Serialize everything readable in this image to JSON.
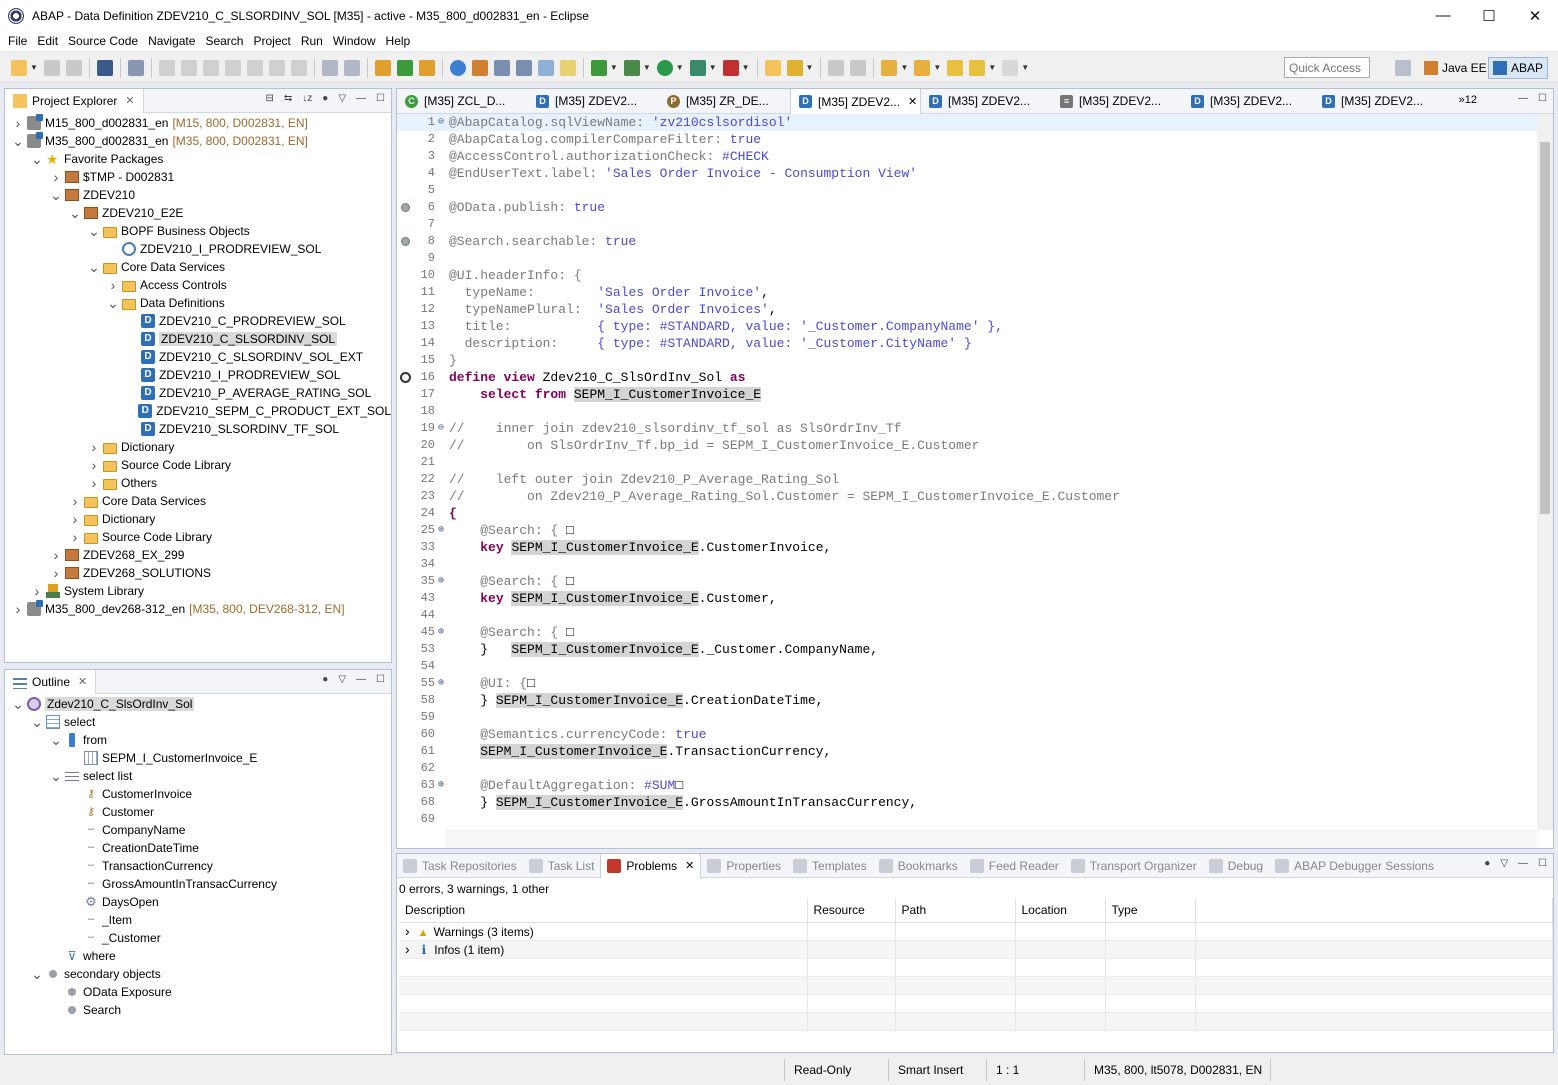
{
  "window": {
    "title": "ABAP - Data Definition ZDEV210_C_SLSORDINV_SOL [M35] - active - M35_800_d002831_en - Eclipse",
    "controls": [
      "—",
      "☐",
      "✕"
    ]
  },
  "menu": [
    "File",
    "Edit",
    "Source Code",
    "Navigate",
    "Search",
    "Project",
    "Run",
    "Window",
    "Help"
  ],
  "toolbar": {
    "quick_access_placeholder": "Quick Access",
    "perspectives": [
      "Java EE",
      "ABAP"
    ]
  },
  "project_explorer": {
    "tab_label": "Project Explorer",
    "tree": [
      {
        "indent": 0,
        "twisty": ">",
        "icon": "proj",
        "label": "M15_800_d002831_en",
        "meta": "[M15, 800, D002831, EN]"
      },
      {
        "indent": 0,
        "twisty": "v",
        "icon": "proj",
        "label": "M35_800_d002831_en",
        "meta": "[M35, 800, D002831, EN]"
      },
      {
        "indent": 1,
        "twisty": "v",
        "icon": "star",
        "label": "Favorite Packages"
      },
      {
        "indent": 2,
        "twisty": ">",
        "icon": "pkg",
        "label": "$TMP - D002831"
      },
      {
        "indent": 2,
        "twisty": "v",
        "icon": "pkg",
        "label": "ZDEV210"
      },
      {
        "indent": 3,
        "twisty": "v",
        "icon": "pkg",
        "label": "ZDEV210_E2E"
      },
      {
        "indent": 4,
        "twisty": "v",
        "icon": "folder",
        "label": "BOPF Business Objects"
      },
      {
        "indent": 5,
        "twisty": "",
        "icon": "bopf",
        "label": "ZDEV210_I_PRODREVIEW_SOL"
      },
      {
        "indent": 4,
        "twisty": "v",
        "icon": "folder",
        "label": "Core Data Services"
      },
      {
        "indent": 5,
        "twisty": ">",
        "icon": "folder",
        "label": "Access Controls"
      },
      {
        "indent": 5,
        "twisty": "v",
        "icon": "folder",
        "label": "Data Definitions"
      },
      {
        "indent": 6,
        "twisty": "",
        "icon": "ddl",
        "label": "ZDEV210_C_PRODREVIEW_SOL"
      },
      {
        "indent": 6,
        "twisty": "",
        "icon": "ddl",
        "label": "ZDEV210_C_SLSORDINV_SOL",
        "selected": true
      },
      {
        "indent": 6,
        "twisty": "",
        "icon": "ddl",
        "label": "ZDEV210_C_SLSORDINV_SOL_EXT"
      },
      {
        "indent": 6,
        "twisty": "",
        "icon": "ddl",
        "label": "ZDEV210_I_PRODREVIEW_SOL"
      },
      {
        "indent": 6,
        "twisty": "",
        "icon": "ddl",
        "label": "ZDEV210_P_AVERAGE_RATING_SOL"
      },
      {
        "indent": 6,
        "twisty": "",
        "icon": "ddl",
        "label": "ZDEV210_SEPM_C_PRODUCT_EXT_SOL"
      },
      {
        "indent": 6,
        "twisty": "",
        "icon": "ddl",
        "label": "ZDEV210_SLSORDINV_TF_SOL"
      },
      {
        "indent": 4,
        "twisty": ">",
        "icon": "folder",
        "label": "Dictionary"
      },
      {
        "indent": 4,
        "twisty": ">",
        "icon": "folder",
        "label": "Source Code Library"
      },
      {
        "indent": 4,
        "twisty": ">",
        "icon": "folder",
        "label": "Others"
      },
      {
        "indent": 3,
        "twisty": ">",
        "icon": "folder",
        "label": "Core Data Services"
      },
      {
        "indent": 3,
        "twisty": ">",
        "icon": "folder",
        "label": "Dictionary"
      },
      {
        "indent": 3,
        "twisty": ">",
        "icon": "folder",
        "label": "Source Code Library"
      },
      {
        "indent": 2,
        "twisty": ">",
        "icon": "pkg",
        "label": "ZDEV268_EX_299"
      },
      {
        "indent": 2,
        "twisty": ">",
        "icon": "pkg",
        "label": "ZDEV268_SOLUTIONS"
      },
      {
        "indent": 1,
        "twisty": ">",
        "icon": "sys",
        "label": "System Library"
      },
      {
        "indent": 0,
        "twisty": ">",
        "icon": "proj",
        "label": "M35_800_dev268-312_en",
        "meta": "[M35, 800, DEV268-312, EN]"
      }
    ]
  },
  "outline": {
    "tab_label": "Outline",
    "tree": [
      {
        "indent": 0,
        "twisty": "v",
        "icon": "view",
        "label": "Zdev210_C_SlsOrdInv_Sol",
        "selected": true
      },
      {
        "indent": 1,
        "twisty": "v",
        "icon": "sel",
        "label": "select"
      },
      {
        "indent": 2,
        "twisty": "v",
        "icon": "from",
        "label": "from"
      },
      {
        "indent": 3,
        "twisty": "",
        "icon": "table",
        "label": "SEPM_I_CustomerInvoice_E"
      },
      {
        "indent": 2,
        "twisty": "v",
        "icon": "list",
        "label": "select list"
      },
      {
        "indent": 3,
        "twisty": "",
        "icon": "key",
        "label": "CustomerInvoice"
      },
      {
        "indent": 3,
        "twisty": "",
        "icon": "key",
        "label": "Customer"
      },
      {
        "indent": 3,
        "twisty": "",
        "icon": "attr",
        "label": "CompanyName"
      },
      {
        "indent": 3,
        "twisty": "",
        "icon": "attr",
        "label": "CreationDateTime"
      },
      {
        "indent": 3,
        "twisty": "",
        "icon": "attr",
        "label": "TransactionCurrency"
      },
      {
        "indent": 3,
        "twisty": "",
        "icon": "attr",
        "label": "GrossAmountInTransacCurrency"
      },
      {
        "indent": 3,
        "twisty": "",
        "icon": "gear",
        "label": "DaysOpen"
      },
      {
        "indent": 3,
        "twisty": "",
        "icon": "attr",
        "label": "_Item"
      },
      {
        "indent": 3,
        "twisty": "",
        "icon": "attr",
        "label": "_Customer"
      },
      {
        "indent": 2,
        "twisty": "",
        "icon": "filter",
        "label": "where"
      },
      {
        "indent": 1,
        "twisty": "v",
        "icon": "dot",
        "label": "secondary objects"
      },
      {
        "indent": 2,
        "twisty": "",
        "icon": "dot",
        "label": "OData Exposure"
      },
      {
        "indent": 2,
        "twisty": "",
        "icon": "dot",
        "label": "Search"
      }
    ]
  },
  "editor": {
    "tabs": [
      {
        "icon": "cls",
        "label": "[M35] ZCL_D..."
      },
      {
        "icon": "ddl",
        "label": "[M35] ZDEV2..."
      },
      {
        "icon": "bdef",
        "label": "[M35] ZR_DE..."
      },
      {
        "icon": "ddl",
        "label": "[M35] ZDEV2...",
        "active": true
      },
      {
        "icon": "ddl",
        "label": "[M35] ZDEV2..."
      },
      {
        "icon": "multi",
        "label": "[M35] ZDEV2..."
      },
      {
        "icon": "ddl",
        "label": "[M35] ZDEV2..."
      },
      {
        "icon": "ddl",
        "label": "[M35] ZDEV2..."
      }
    ],
    "overflow_count": "»12",
    "lines": [
      {
        "n": "1",
        "fold": "⊖",
        "segs": [
          [
            "a",
            "@AbapCatalog.sqlViewName: "
          ],
          [
            "s",
            "'zv210cslsordisol'"
          ]
        ]
      },
      {
        "n": "2",
        "segs": [
          [
            "a",
            "@AbapCatalog.compilerCompareFilter: "
          ],
          [
            "s",
            "true"
          ]
        ]
      },
      {
        "n": "3",
        "segs": [
          [
            "a",
            "@AccessControl.authorizationCheck: "
          ],
          [
            "s",
            "#CHECK"
          ]
        ]
      },
      {
        "n": "4",
        "segs": [
          [
            "a",
            "@EndUserText.label: "
          ],
          [
            "s",
            "'Sales Order Invoice - Consumption View'"
          ]
        ]
      },
      {
        "n": "5",
        "segs": []
      },
      {
        "n": "6",
        "mark": "bp",
        "segs": [
          [
            "a",
            "@OData.publish: "
          ],
          [
            "s",
            "true"
          ]
        ]
      },
      {
        "n": "7",
        "segs": []
      },
      {
        "n": "8",
        "mark": "bp",
        "segs": [
          [
            "a",
            "@Search.searchable: "
          ],
          [
            "s",
            "true"
          ]
        ]
      },
      {
        "n": "9",
        "segs": []
      },
      {
        "n": "10",
        "segs": [
          [
            "a",
            "@UI.headerInfo: {"
          ]
        ]
      },
      {
        "n": "11",
        "segs": [
          [
            "a",
            "  typeName:        "
          ],
          [
            "s",
            "'Sales Order Invoice'"
          ],
          [
            "t",
            ","
          ]
        ]
      },
      {
        "n": "12",
        "segs": [
          [
            "a",
            "  typeNamePlural:  "
          ],
          [
            "s",
            "'Sales Order Invoices'"
          ],
          [
            "t",
            ","
          ]
        ]
      },
      {
        "n": "13",
        "segs": [
          [
            "a",
            "  title:           "
          ],
          [
            "s",
            "{ type: #STANDARD, value: '_Customer.CompanyName' },"
          ]
        ]
      },
      {
        "n": "14",
        "segs": [
          [
            "a",
            "  description:     "
          ],
          [
            "s",
            "{ type: #STANDARD, value: '_Customer.CityName' }"
          ]
        ]
      },
      {
        "n": "15",
        "segs": [
          [
            "a",
            "}"
          ]
        ]
      },
      {
        "n": "16",
        "mark": "tgt",
        "segs": [
          [
            "k",
            "define view "
          ],
          [
            "t",
            "Zdev210_C_SlsOrdInv_Sol "
          ],
          [
            "k",
            "as"
          ]
        ]
      },
      {
        "n": "17",
        "segs": [
          [
            "t",
            "    "
          ],
          [
            "k",
            "select from "
          ],
          [
            "h",
            "SEPM_I_CustomerInvoice_E"
          ]
        ]
      },
      {
        "n": "18",
        "segs": []
      },
      {
        "n": "19",
        "fold": "⊖",
        "segs": [
          [
            "c",
            "//    inner join zdev210_slsordinv_tf_sol as SlsOrdrInv_Tf"
          ]
        ]
      },
      {
        "n": "20",
        "segs": [
          [
            "c",
            "//        on SlsOrdrInv_Tf.bp_id = SEPM_I_CustomerInvoice_E.Customer"
          ]
        ]
      },
      {
        "n": "21",
        "segs": []
      },
      {
        "n": "22",
        "segs": [
          [
            "c",
            "//    left outer join Zdev210_P_Average_Rating_Sol"
          ]
        ]
      },
      {
        "n": "23",
        "segs": [
          [
            "c",
            "//        on Zdev210_P_Average_Rating_Sol.Customer = SEPM_I_CustomerInvoice_E.Customer"
          ]
        ]
      },
      {
        "n": "24",
        "segs": [
          [
            "k",
            "{"
          ]
        ]
      },
      {
        "n": "25",
        "fold": "⊕",
        "segs": [
          [
            "t",
            "    "
          ],
          [
            "a",
            "@Search: { "
          ],
          [
            "t",
            "□"
          ]
        ]
      },
      {
        "n": "33",
        "segs": [
          [
            "t",
            "    "
          ],
          [
            "k",
            "key "
          ],
          [
            "h",
            "SEPM_I_CustomerInvoice_E"
          ],
          [
            "t",
            ".CustomerInvoice,"
          ]
        ]
      },
      {
        "n": "34",
        "segs": []
      },
      {
        "n": "35",
        "fold": "⊕",
        "segs": [
          [
            "t",
            "    "
          ],
          [
            "a",
            "@Search: { "
          ],
          [
            "t",
            "□"
          ]
        ]
      },
      {
        "n": "43",
        "segs": [
          [
            "t",
            "    "
          ],
          [
            "k",
            "key "
          ],
          [
            "h",
            "SEPM_I_CustomerInvoice_E"
          ],
          [
            "t",
            ".Customer,"
          ]
        ]
      },
      {
        "n": "44",
        "segs": []
      },
      {
        "n": "45",
        "fold": "⊕",
        "segs": [
          [
            "t",
            "    "
          ],
          [
            "a",
            "@Search: { "
          ],
          [
            "t",
            "□"
          ]
        ]
      },
      {
        "n": "53",
        "segs": [
          [
            "t",
            "    }   "
          ],
          [
            "h",
            "SEPM_I_CustomerInvoice_E"
          ],
          [
            "t",
            "._Customer.CompanyName,"
          ]
        ]
      },
      {
        "n": "54",
        "segs": []
      },
      {
        "n": "55",
        "fold": "⊕",
        "segs": [
          [
            "t",
            "    "
          ],
          [
            "a",
            "@UI: {"
          ],
          [
            "t",
            "□"
          ]
        ]
      },
      {
        "n": "58",
        "segs": [
          [
            "t",
            "    } "
          ],
          [
            "h",
            "SEPM_I_CustomerInvoice_E"
          ],
          [
            "t",
            ".CreationDateTime,"
          ]
        ]
      },
      {
        "n": "59",
        "segs": []
      },
      {
        "n": "60",
        "segs": [
          [
            "t",
            "    "
          ],
          [
            "a",
            "@Semantics.currencyCode: "
          ],
          [
            "s",
            "true"
          ]
        ]
      },
      {
        "n": "61",
        "segs": [
          [
            "t",
            "    "
          ],
          [
            "h",
            "SEPM_I_CustomerInvoice_E"
          ],
          [
            "t",
            ".TransactionCurrency,"
          ]
        ]
      },
      {
        "n": "62",
        "segs": []
      },
      {
        "n": "63",
        "fold": "⊕",
        "segs": [
          [
            "t",
            "    "
          ],
          [
            "a",
            "@DefaultAggregation: "
          ],
          [
            "s",
            "#SUM"
          ],
          [
            "t",
            "□"
          ]
        ]
      },
      {
        "n": "68",
        "segs": [
          [
            "t",
            "    } "
          ],
          [
            "h",
            "SEPM_I_CustomerInvoice_E"
          ],
          [
            "t",
            ".GrossAmountInTransacCurrency,"
          ]
        ]
      },
      {
        "n": "69",
        "segs": []
      }
    ]
  },
  "problems": {
    "tabs": [
      "Task Repositories",
      "Task List",
      "Problems",
      "Properties",
      "Templates",
      "Bookmarks",
      "Feed Reader",
      "Transport Organizer",
      "Debug",
      "ABAP Debugger Sessions"
    ],
    "active_tab": "Problems",
    "summary": "0 errors, 3 warnings, 1 other",
    "columns": [
      "Description",
      "Resource",
      "Path",
      "Location",
      "Type"
    ],
    "rows": [
      {
        "kind": "warn",
        "description": "Warnings (3 items)"
      },
      {
        "kind": "info",
        "description": "Infos (1 item)"
      }
    ]
  },
  "status": {
    "mode": "Read-Only",
    "insert": "Smart Insert",
    "position": "1 : 1",
    "system": "M35, 800, lt5078, D002831, EN"
  },
  "colors": {
    "accent": "#2f6fb6",
    "keyword": "#7f0055",
    "string": "#4a4ad0",
    "annotation": "#7a7a7a"
  }
}
